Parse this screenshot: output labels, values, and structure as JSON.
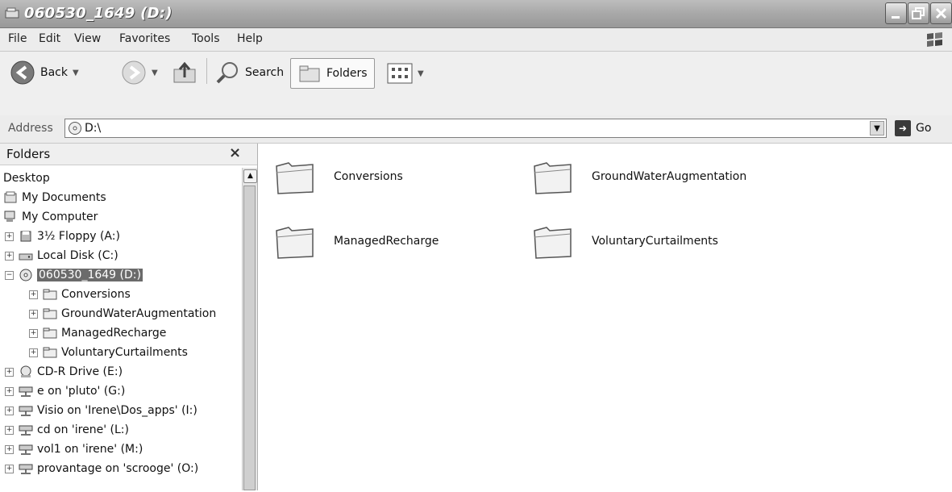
{
  "window": {
    "title": "060530_1649 (D:)"
  },
  "menu": {
    "items": [
      "File",
      "Edit",
      "View",
      "Favorites",
      "Tools",
      "Help"
    ]
  },
  "toolbar": {
    "back_label": "Back",
    "search_label": "Search",
    "folders_label": "Folders"
  },
  "address": {
    "label": "Address",
    "value": "D:\\",
    "go_label": "Go"
  },
  "folders_pane": {
    "title": "Folders",
    "tree": [
      {
        "label": "Desktop",
        "icon": "none"
      },
      {
        "label": "My Documents",
        "icon": "documents-icon"
      },
      {
        "label": "My Computer",
        "icon": "computer-icon"
      },
      {
        "label": "3½ Floppy (A:)",
        "icon": "floppy-icon"
      },
      {
        "label": "Local Disk (C:)",
        "icon": "hard-disk-icon"
      },
      {
        "label": "060530_1649 (D:)",
        "icon": "cd-drive-icon",
        "selected": true
      },
      {
        "label": "Conversions",
        "icon": "folder-icon"
      },
      {
        "label": "GroundWaterAugmentation",
        "icon": "folder-icon"
      },
      {
        "label": "ManagedRecharge",
        "icon": "folder-icon"
      },
      {
        "label": "VoluntaryCurtailments",
        "icon": "folder-icon"
      },
      {
        "label": "CD-R Drive (E:)",
        "icon": "cd-drive-icon"
      },
      {
        "label": "e on 'pluto' (G:)",
        "icon": "network-drive-icon"
      },
      {
        "label": "Visio on 'Irene\\Dos_apps' (I:)",
        "icon": "network-drive-icon"
      },
      {
        "label": "cd on 'irene' (L:)",
        "icon": "network-drive-icon"
      },
      {
        "label": "vol1 on 'irene' (M:)",
        "icon": "network-drive-icon"
      },
      {
        "label": "provantage on 'scrooge' (O:)",
        "icon": "network-drive-icon"
      }
    ]
  },
  "content": {
    "folders": [
      "Conversions",
      "GroundWaterAugmentation",
      "ManagedRecharge",
      "VoluntaryCurtailments"
    ]
  }
}
